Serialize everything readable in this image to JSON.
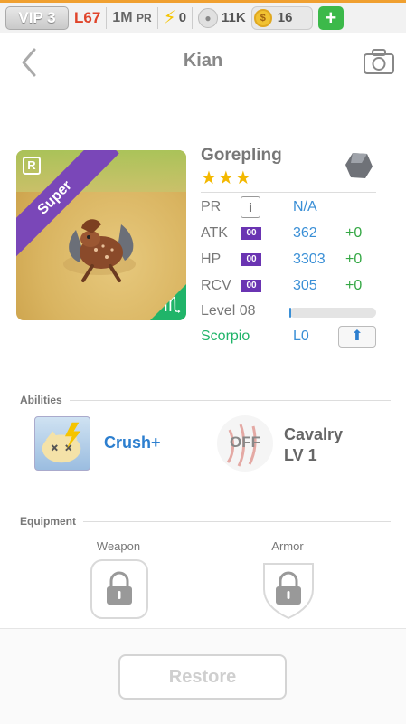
{
  "status_bar": {
    "vip": "VIP 3",
    "level": "L67",
    "pr_value": "1M",
    "pr_unit": "PR",
    "energy": "0",
    "paws": "11K",
    "coins": "16",
    "add_label": "+"
  },
  "header": {
    "title": "Kian",
    "back_icon": "chevron-left-icon",
    "camera_icon": "camera-icon"
  },
  "monster": {
    "name": "Gorepling",
    "stars": "★★★",
    "rarity_badge": "R",
    "grade_ribbon": "Super",
    "zodiac_symbol": "♏",
    "stats": [
      {
        "label": "PR",
        "value": "N/A"
      },
      {
        "label": "ATK",
        "box": "00",
        "value": "362",
        "bonus": "+0"
      },
      {
        "label": "HP",
        "box": "00",
        "value": "3303",
        "bonus": "+0"
      },
      {
        "label": "RCV",
        "box": "00",
        "value": "305",
        "bonus": "+0"
      }
    ],
    "info_label": "i",
    "level_label": "Level 08",
    "level_progress": 0.02,
    "sign_label": "Scorpio",
    "sign_level": "L0",
    "upgrade_icon": "arrow-up-icon"
  },
  "abilities": {
    "section_label": "Abilities",
    "skill_name": "Crush+",
    "off_label": "OFF",
    "passive_name": "Cavalry",
    "passive_level": "LV 1"
  },
  "equipment": {
    "section_label": "Equipment",
    "weapon_label": "Weapon",
    "armor_label": "Armor"
  },
  "footer": {
    "restore_label": "Restore"
  },
  "colors": {
    "accent_blue": "#3a8fd6",
    "green": "#35a845",
    "purple": "#6a34b2",
    "level_red": "#e0442a"
  }
}
